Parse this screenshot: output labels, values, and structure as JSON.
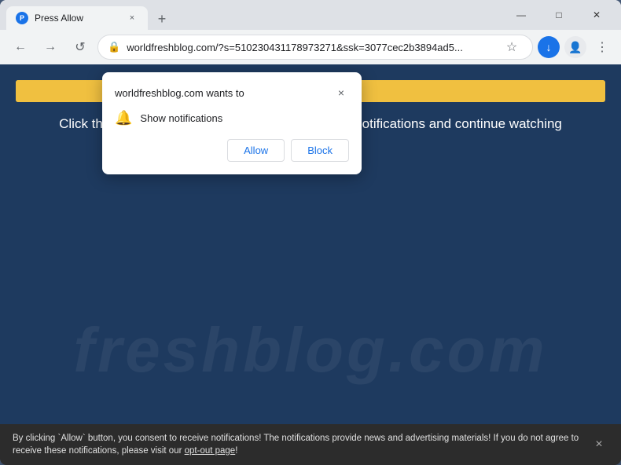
{
  "browser": {
    "tab": {
      "favicon_label": "P",
      "title": "Press Allow",
      "close_label": "×"
    },
    "new_tab_label": "+",
    "window_controls": {
      "minimize": "—",
      "maximize": "□",
      "close": "✕"
    },
    "nav": {
      "back_label": "←",
      "forward_label": "→",
      "refresh_label": "↺",
      "url": "worldfreshblog.com/?s=510230431178973271&ssk=3077cec2b3894ad5...",
      "star_label": "☆",
      "download_label": "↓",
      "profile_label": "👤",
      "menu_label": "⋮"
    }
  },
  "notification_popup": {
    "title": "worldfreshblog.com wants to",
    "close_label": "×",
    "notification_label": "Show notifications",
    "allow_label": "Allow",
    "block_label": "Block"
  },
  "page": {
    "progress_value": "99%",
    "instruction": "Click the «Allow» button to subscribe to the push notifications and continue watching",
    "watermark": "freshblog.com"
  },
  "consent_bar": {
    "text": "By clicking `Allow` button, you consent to receive notifications! The notifications provide news and advertising materials! If you do not agree to receive these notifications, please visit our ",
    "opt_out_label": "opt-out page",
    "text_suffix": "!",
    "close_label": "×"
  },
  "colors": {
    "page_bg": "#1e3a5f",
    "progress_yellow": "#f0c040",
    "consent_bg": "#2c2c2c",
    "popup_bg": "#ffffff",
    "button_color": "#1a73e8"
  }
}
